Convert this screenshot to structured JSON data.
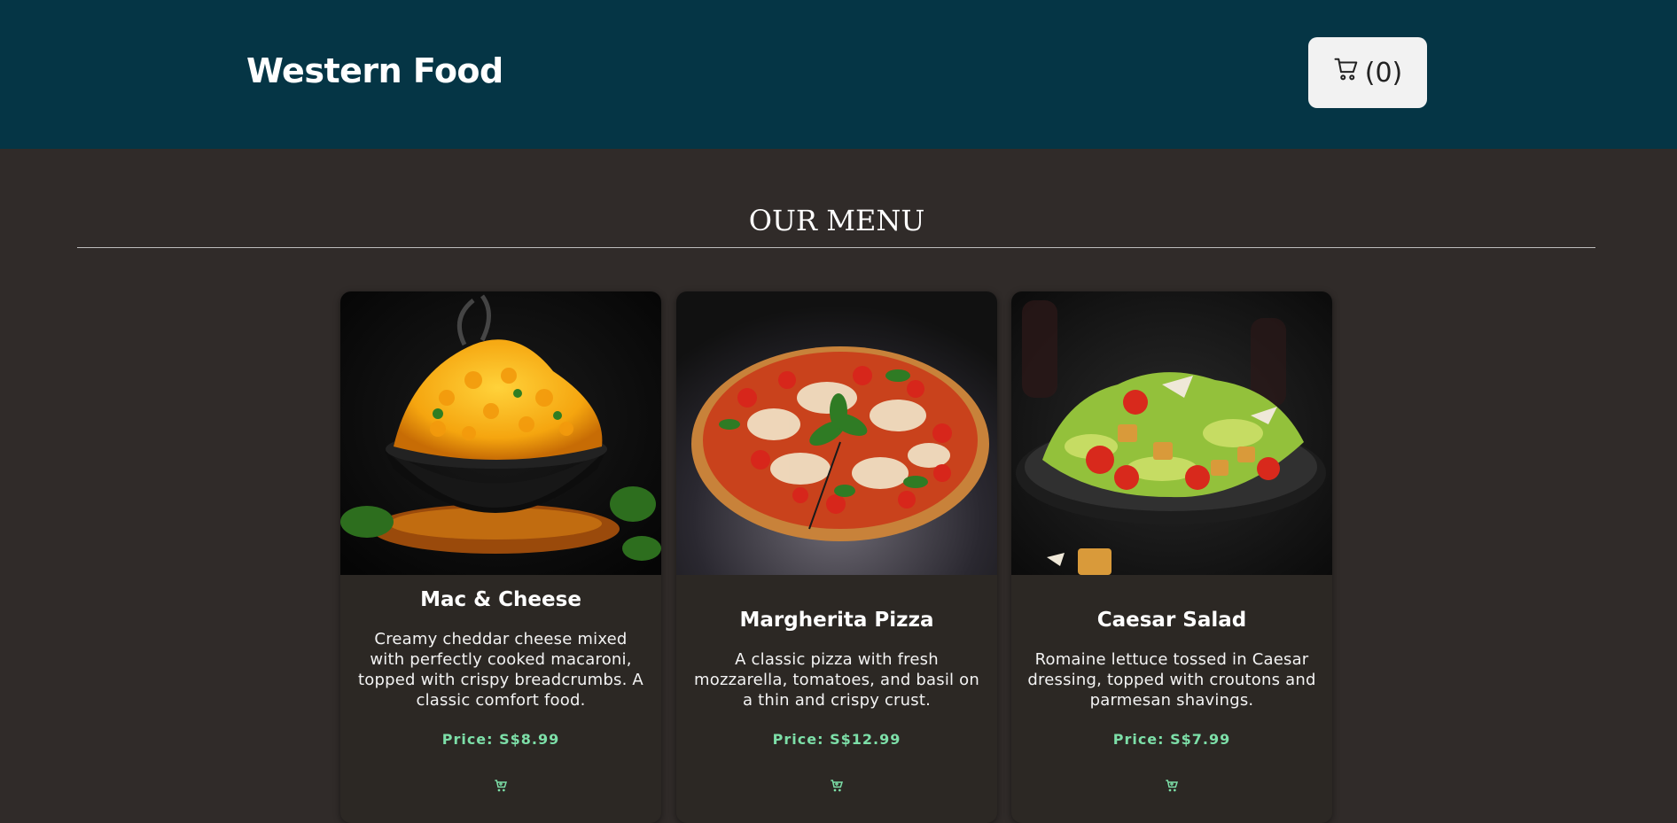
{
  "header": {
    "brand": "Western Food",
    "cart_count_text": "(0)",
    "cart_icon": "shopping-cart-icon"
  },
  "menu": {
    "heading": "OUR MENU",
    "items": [
      {
        "name": "Mac & Cheese",
        "description": "Creamy cheddar cheese mixed with perfectly cooked macaroni, topped with crispy breadcrumbs. A classic comfort food.",
        "price": "Price: S$8.99",
        "icon": "add-to-cart-icon"
      },
      {
        "name": "Margherita Pizza",
        "description": "A classic pizza with fresh mozzarella, tomatoes, and basil on a thin and crispy crust.",
        "price": "Price: S$12.99",
        "icon": "add-to-cart-icon"
      },
      {
        "name": "Caesar Salad",
        "description": "Romaine lettuce tossed in Caesar dressing, topped with croutons and parmesan shavings.",
        "price": "Price: S$7.99",
        "icon": "add-to-cart-icon"
      }
    ]
  },
  "colors": {
    "header_bg": "#053545",
    "page_bg": "#302b29",
    "card_bg": "#2c2824",
    "price": "#7ddfa8"
  }
}
